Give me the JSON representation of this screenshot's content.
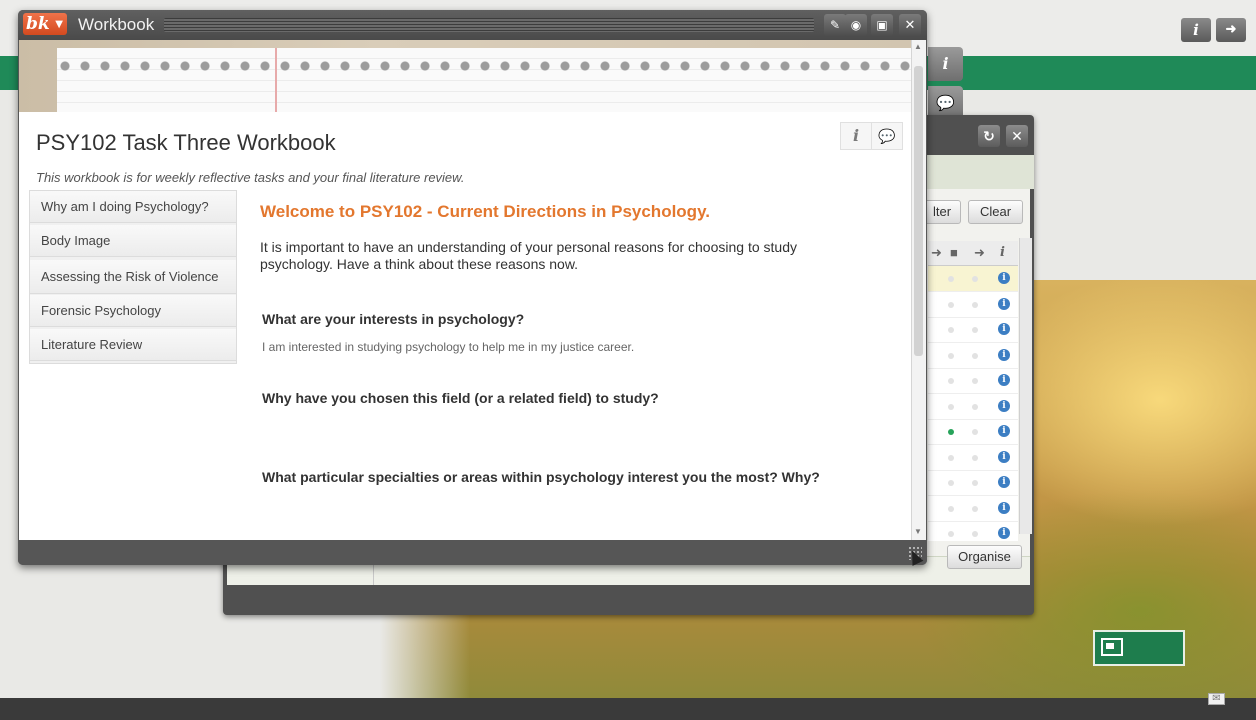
{
  "workbook": {
    "window_title": "Workbook",
    "app_logo": "bk",
    "heading": "PSY102 Task Three Workbook",
    "description": "This workbook is for weekly reflective tasks and your final literature review.",
    "nav": [
      {
        "label": "Why am I doing Psychology?"
      },
      {
        "label": "Body Image"
      },
      {
        "label": "Assessing the Risk of Violence"
      },
      {
        "label": "Forensic Psychology"
      },
      {
        "label": "Literature Review"
      }
    ],
    "welcome_title": "Welcome to PSY102 - Current Directions in Psychology.",
    "intro": "It is important to have an understanding of your personal reasons for choosing to study psychology. Have a think about these reasons now.",
    "questions": [
      {
        "question": "What are your interests in psychology?",
        "answer": "I am interested in studying psychology to help me in my justice career."
      },
      {
        "question": "Why have you chosen this field (or a related field) to study?",
        "answer": ""
      },
      {
        "question": "What particular specialties or areas within psychology interest you the most? Why?",
        "answer": ""
      }
    ],
    "titlebar_icons": [
      "pencil-icon",
      "eye-icon",
      "display-icon",
      "close-icon"
    ]
  },
  "background_window": {
    "filter_label": "lter",
    "clear_label": "Clear",
    "organise_label": "Organise",
    "green_dot_row": 6,
    "rows": 11
  },
  "desktop": {
    "info_glyph": "i",
    "accent": "#1f8a58",
    "welcome_color": "#e3772e",
    "logo_color": "#e05a2b"
  }
}
